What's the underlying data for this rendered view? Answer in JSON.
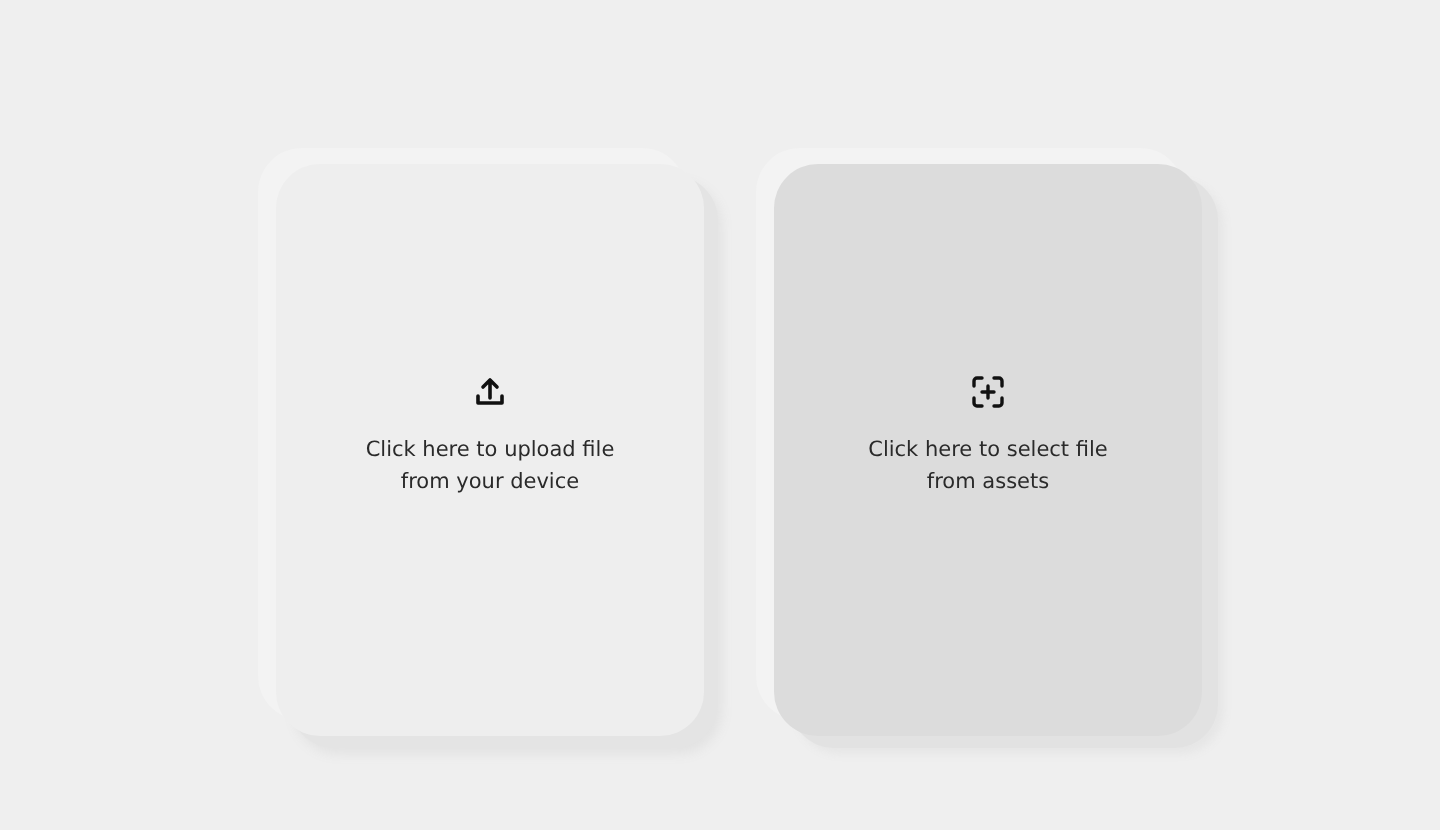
{
  "options": [
    {
      "kind": "upload",
      "selected": false,
      "lines": [
        "Click here to upload file",
        "from your device"
      ]
    },
    {
      "kind": "assets",
      "selected": true,
      "lines": [
        "Click here to select file",
        "from assets"
      ]
    }
  ]
}
